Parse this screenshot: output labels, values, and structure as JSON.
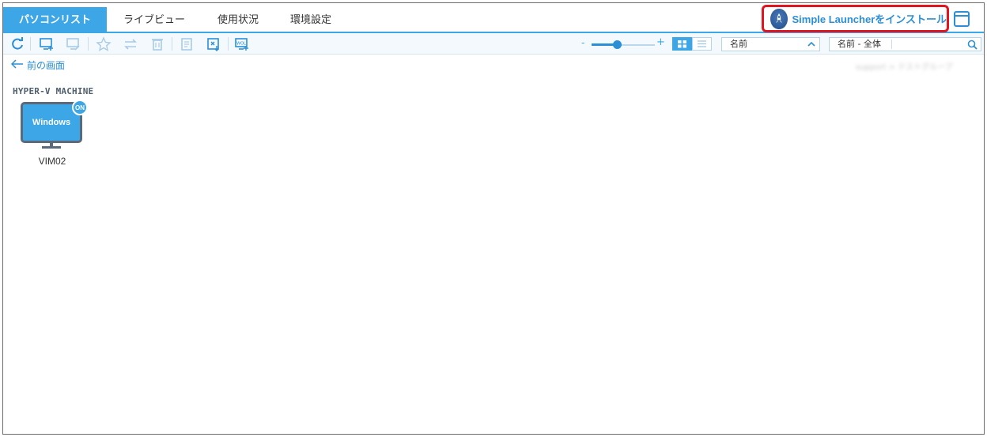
{
  "tabs": [
    {
      "label": "パソコンリスト",
      "active": true
    },
    {
      "label": "ライブビュー",
      "active": false
    },
    {
      "label": "使用状況",
      "active": false
    },
    {
      "label": "環境設定",
      "active": false
    }
  ],
  "header": {
    "install_label": "Simple Launcherをインストール",
    "window_icon": "window-icon"
  },
  "toolbar": {
    "icons": [
      "refresh-icon",
      "add-pc-icon",
      "edit-pc-icon",
      "favorite-icon",
      "transfer-icon",
      "delete-icon",
      "notes-icon",
      "export-icon",
      "wol-icon"
    ],
    "zoom_minus": "-",
    "zoom_plus": "+",
    "zoom_level": 0.4,
    "sort_value": "名前",
    "search_scope": "名前 - 全体"
  },
  "content": {
    "back_label": "前の画面",
    "blurred_crumb": "support > テストグループ",
    "group_title": "HYPER-V MACHINE",
    "machines": [
      {
        "name": "VIM02",
        "os": "Windows",
        "status": "ON"
      }
    ]
  },
  "colors": {
    "accent": "#3da6e6",
    "install_border": "#e0151e",
    "link": "#2b8fd6"
  }
}
